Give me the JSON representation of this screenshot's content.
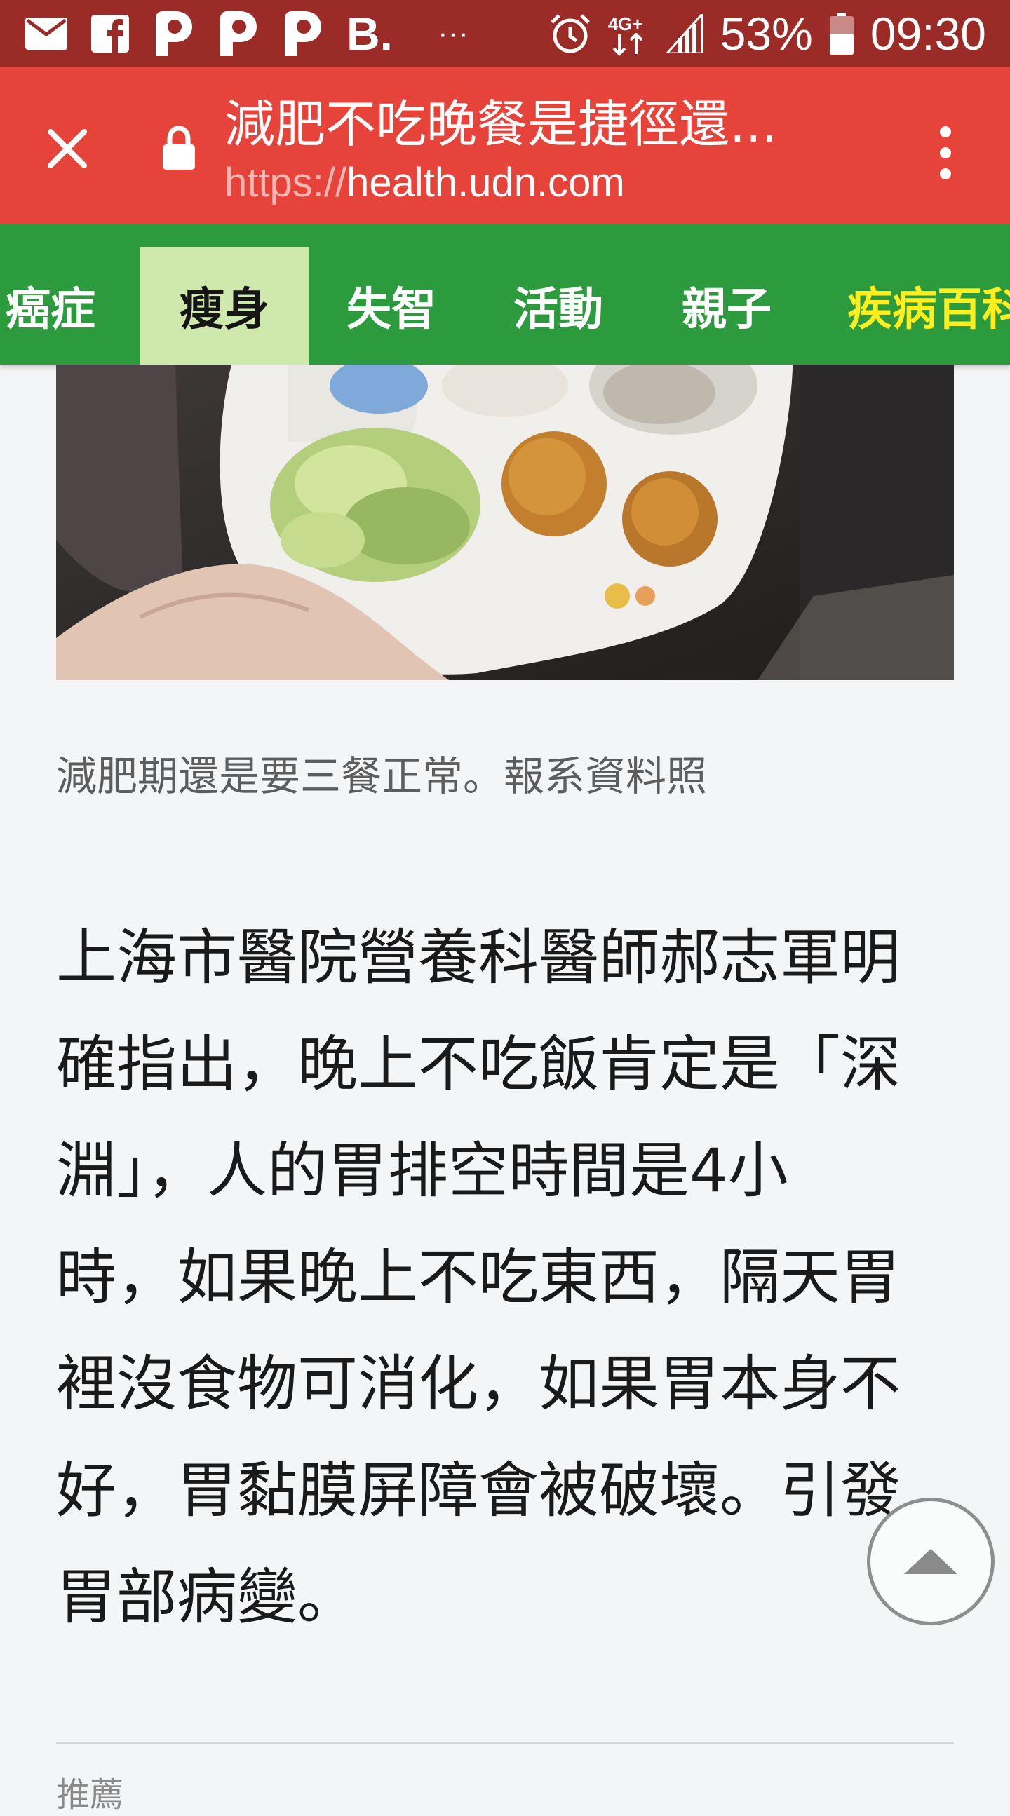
{
  "status_bar": {
    "notification_icons": [
      "mail-icon",
      "facebook-icon",
      "p-app-icon",
      "p-app-icon",
      "p-app-icon",
      "b-app-icon"
    ],
    "b_app_label": "B.",
    "overflow": "···",
    "network": "4G+",
    "battery_percent": "53%",
    "time": "09:30"
  },
  "browser": {
    "page_title": "減肥不吃晚餐是捷徑還...",
    "url_scheme": "https://",
    "url_host": "health.udn.com"
  },
  "category_nav": {
    "tabs": [
      {
        "label": "癌症",
        "state": "normal"
      },
      {
        "label": "瘦身",
        "state": "active"
      },
      {
        "label": "失智",
        "state": "normal"
      },
      {
        "label": "活動",
        "state": "normal"
      },
      {
        "label": "親子",
        "state": "normal"
      },
      {
        "label": "疾病百科",
        "state": "highlight"
      }
    ],
    "colors": {
      "bar": "#2b9b3d",
      "active_bg": "#cfe9ad",
      "highlight_text": "#ffef1f"
    }
  },
  "article": {
    "caption": "減肥期還是要三餐正常。報系資料照",
    "body_lines": [
      "上海市醫院營養科醫師郝志軍明",
      "確指出，晚上不吃飯肯定是「深",
      "淵」，人的胃排空時間是4小",
      "時，如果晚上不吃東西，隔天胃",
      "裡沒食物可消化，如果胃本身不",
      "好，胃黏膜屏障會被破壞。引發",
      "胃部病變。"
    ]
  },
  "recommend_label": "推薦",
  "colors": {
    "status_bar": "#9b2b26",
    "url_bar": "#e6433b",
    "page_bg": "#f4f5f7"
  }
}
